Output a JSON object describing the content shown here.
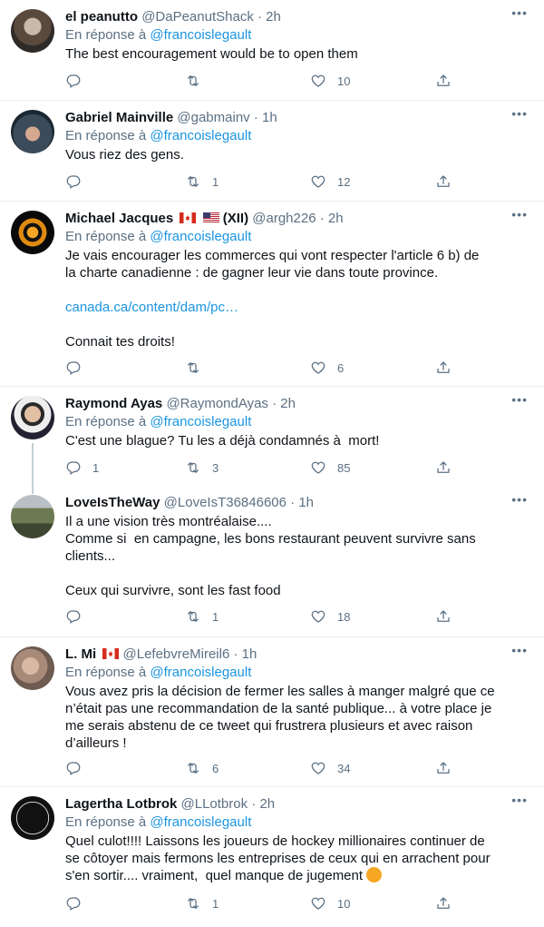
{
  "reply_prefix": "En réponse à",
  "reply_to": "@francoislegault",
  "tweets": [
    {
      "name": "el peanutto",
      "handle": "@DaPeanutShack",
      "time": "2h",
      "text": "The best encouragement would be to open them",
      "replies": "",
      "retweets": "",
      "likes": "10"
    },
    {
      "name": "Gabriel Mainville",
      "handle": "@gabmainv",
      "time": "1h",
      "text": "Vous riez des gens.",
      "replies": "",
      "retweets": "1",
      "likes": "12"
    },
    {
      "name": "Michael Jacques",
      "name_suffix": "(XII)",
      "handle": "@argh226",
      "time": "2h",
      "text": "Je vais encourager les commerces qui vont respecter l'article 6 b) de\nla charte canadienne : de gagner leur vie dans toute province.",
      "link": "canada.ca/content/dam/pc…",
      "text2": "Connait tes droits!",
      "replies": "",
      "retweets": "",
      "likes": "6"
    },
    {
      "name": "Raymond Ayas",
      "handle": "@RaymondAyas",
      "time": "2h",
      "text": "C'est une blague? Tu les a déjà condamnés à  mort!",
      "replies": "1",
      "retweets": "3",
      "likes": "85"
    },
    {
      "name": "LoveIsTheWay",
      "handle": "@LoveIsT36846606",
      "time": "1h",
      "text": "Il a une vision très montréalaise....\nComme si  en campagne, les bons restaurant peuvent survivre sans\nclients...\n\nCeux qui survivre, sont les fast food",
      "replies": "",
      "retweets": "1",
      "likes": "18"
    },
    {
      "name": "L. Mi",
      "handle": "@LefebvreMireil6",
      "time": "1h",
      "text": "Vous avez pris la décision de fermer les salles à manger malgré que ce\nn’était pas une recommandation de la santé publique... à votre place je\nme serais abstenu de ce tweet qui frustrera plusieurs et avec raison\nd’ailleurs !",
      "replies": "",
      "retweets": "6",
      "likes": "34"
    },
    {
      "name": "Lagertha Lotbrok",
      "handle": "@LLotbrok",
      "time": "2h",
      "text": "Quel culot!!!! Laissons les joueurs de hockey millionaires continuer de\nse côtoyer mais fermons les entreprises de ceux qui en arrachent pour\ns'en sortir.... vraiment,  quel manque de jugement ",
      "replies": "",
      "retweets": "1",
      "likes": "10"
    }
  ],
  "colors": {
    "link": "#1b95e0",
    "muted": "#5b7083",
    "divider": "#e6ecf0"
  }
}
